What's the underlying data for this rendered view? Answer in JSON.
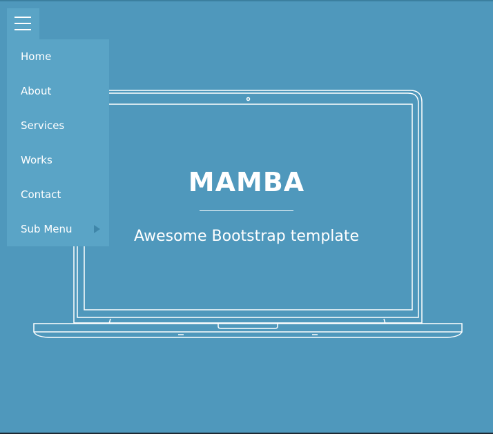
{
  "hero": {
    "title": "MAMBA",
    "subtitle": "Awesome Bootstrap template"
  },
  "menu": {
    "toggle_icon": "hamburger-icon",
    "items": [
      {
        "label": "Home"
      },
      {
        "label": "About"
      },
      {
        "label": "Services"
      },
      {
        "label": "Works"
      },
      {
        "label": "Contact"
      },
      {
        "label": "Sub Menu",
        "icon": "caret-right-icon"
      }
    ]
  },
  "colors": {
    "background": "#4f98bc",
    "menu_background": "#5aa4c6",
    "text": "#ffffff",
    "caret": "#3f86a9"
  }
}
